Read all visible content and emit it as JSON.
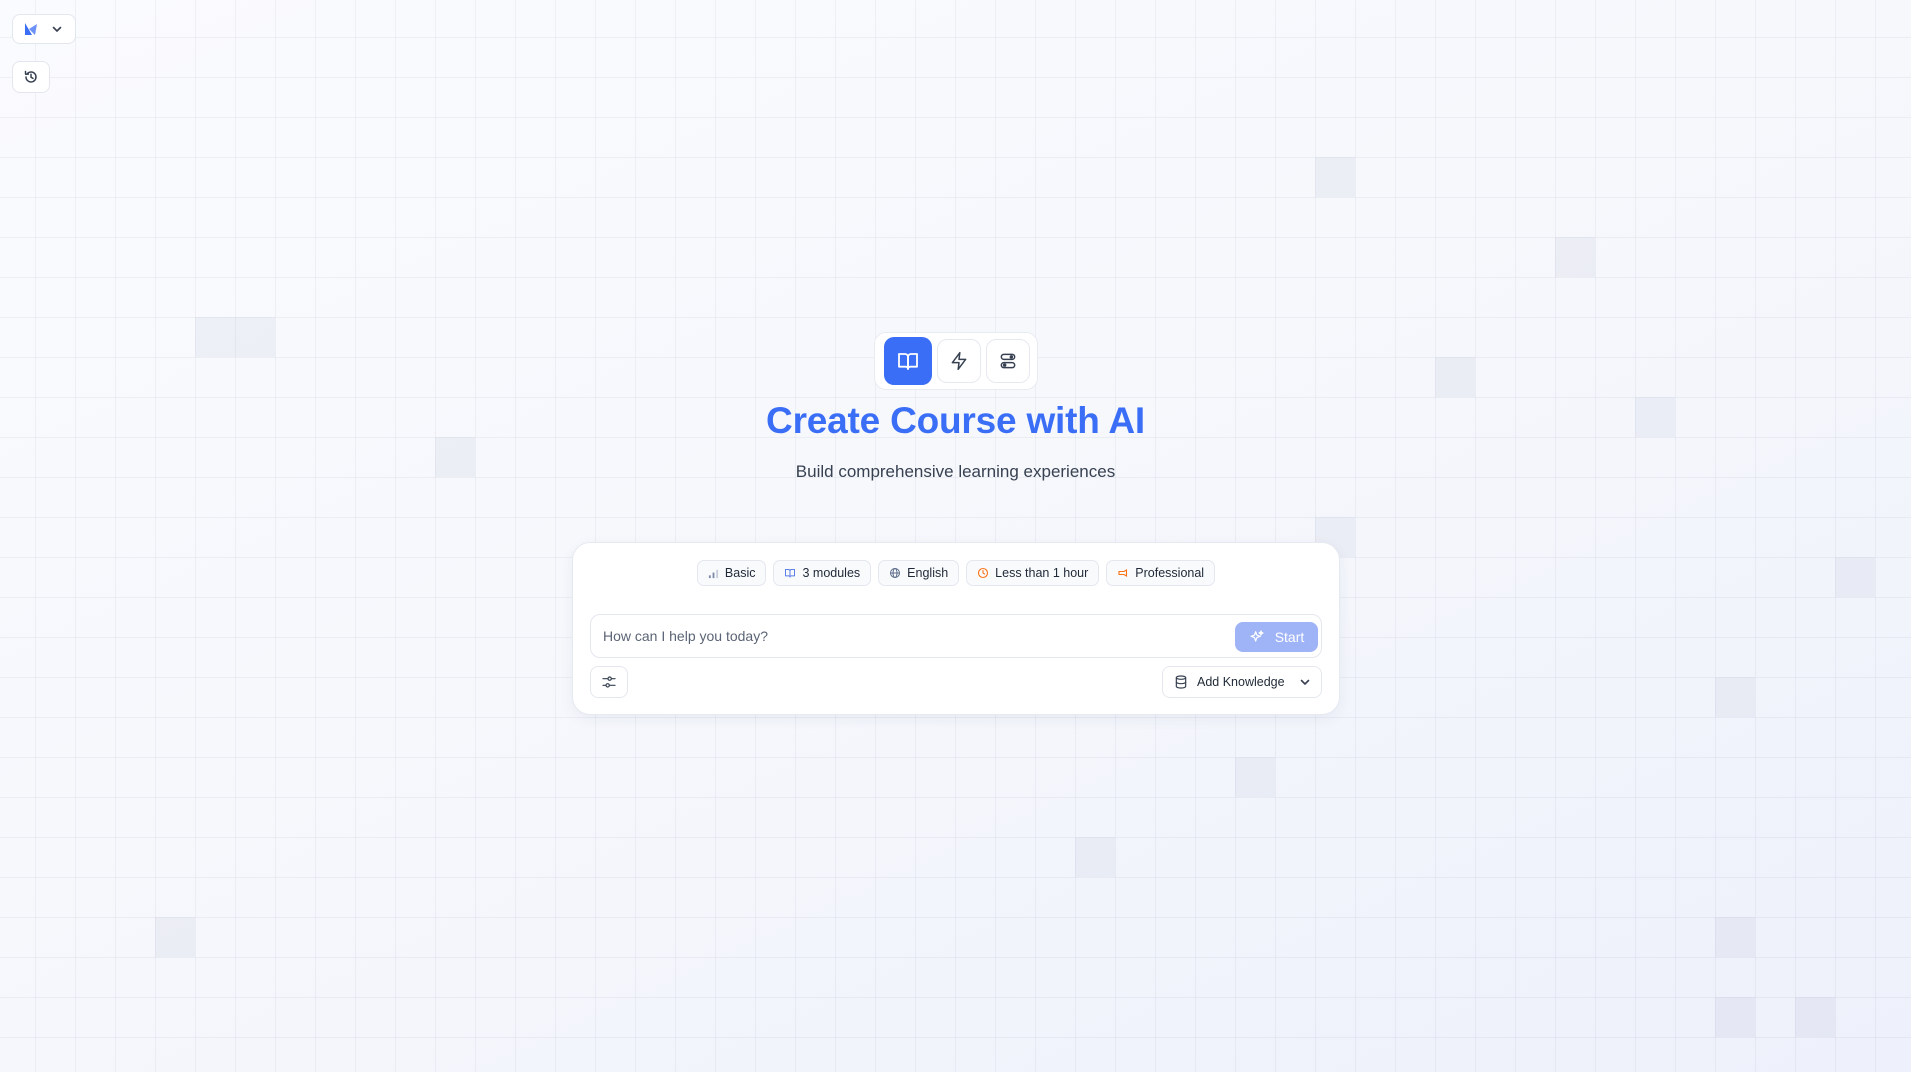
{
  "app": {
    "logo_icon": "logo-icon",
    "brand_menu_icon": "chevron-down-icon",
    "history_icon": "history-icon"
  },
  "modes": {
    "items": [
      {
        "id": "course",
        "icon": "book-open-icon",
        "active": true
      },
      {
        "id": "quick",
        "icon": "lightning-icon",
        "active": false
      },
      {
        "id": "workflow",
        "icon": "route-icon",
        "active": false
      }
    ]
  },
  "hero": {
    "title": "Create Course with AI",
    "subtitle": "Build comprehensive learning experiences"
  },
  "composer": {
    "chips": [
      {
        "label": "Basic",
        "icon": "signal-bars-icon"
      },
      {
        "label": "3 modules",
        "icon": "book-icon"
      },
      {
        "label": "English",
        "icon": "globe-icon"
      },
      {
        "label": "Less than 1 hour",
        "icon": "clock-icon"
      },
      {
        "label": "Professional",
        "icon": "tone-icon"
      }
    ],
    "input_placeholder": "How can I help you today?",
    "input_value": "",
    "start_label": "Start",
    "add_knowledge_label": "Add Knowledge"
  },
  "colors": {
    "accent": "#3b6ef6",
    "start_button": "#9fb3f7",
    "clock_icon": "#f97316",
    "tone_icon": "#f97316"
  }
}
